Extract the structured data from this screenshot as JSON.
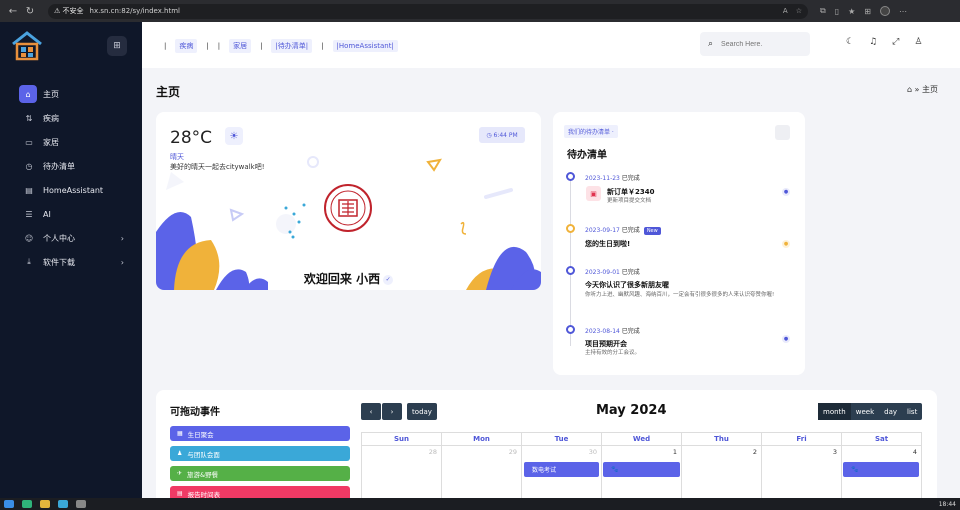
{
  "browser": {
    "security": "不安全",
    "url": "hx.sn.cn:82/sy/index.html"
  },
  "sidebar": {
    "items": [
      {
        "label": "主页",
        "icon": "home-icon"
      },
      {
        "label": "疾病",
        "icon": "route-icon"
      },
      {
        "label": "家居",
        "icon": "monitor-icon"
      },
      {
        "label": "待办清单",
        "icon": "clock-icon"
      },
      {
        "label": "HomeAssistant",
        "icon": "server-icon"
      },
      {
        "label": "AI",
        "icon": "storage-icon"
      },
      {
        "label": "个人中心",
        "icon": "users-icon"
      },
      {
        "label": "软件下载",
        "icon": "download-icon"
      }
    ]
  },
  "header": {
    "nav": [
      "疾病",
      "家居",
      "|待办清单|",
      "|HomeAssistant|"
    ],
    "search_placeholder": "Search Here."
  },
  "page": {
    "title": "主页",
    "breadcrumb": "主页"
  },
  "weather": {
    "temperature": "28°C",
    "condition": "晴天",
    "message": "美好的晴天一起去citywalk吧!",
    "time": "6:44 PM",
    "welcome": "欢迎回来 小西"
  },
  "todo": {
    "tag": "我们的待办清单",
    "title": "待办清单",
    "items": [
      {
        "date": "2023-11-23",
        "status": "已完成",
        "badge": "",
        "title": "新订单￥2340",
        "sub": "更新项目提交文档"
      },
      {
        "date": "2023-09-17",
        "status": "已完成",
        "badge": "New",
        "title": "您的生日到啦!",
        "sub": ""
      },
      {
        "date": "2023-09-01",
        "status": "已完成",
        "badge": "",
        "title": "今天你认识了很多新朋友喔",
        "sub": "你听力上进、幽默风趣、海纳百川，一定会有引很多很多的人来认识夸赞你喔!"
      },
      {
        "date": "2023-08-14",
        "status": "已完成",
        "badge": "",
        "title": "项目预期开会",
        "sub": "主持有效的分工会议。"
      }
    ]
  },
  "calendar": {
    "drag_title": "可拖动事件",
    "events": [
      {
        "label": "生日聚会",
        "color": "#5b63e8"
      },
      {
        "label": "与团队会面",
        "color": "#3aa8d8"
      },
      {
        "label": "旅游&野餐",
        "color": "#55b047"
      },
      {
        "label": "报告时间表",
        "color": "#f03a65"
      }
    ],
    "today_label": "today",
    "month_title": "May 2024",
    "views": [
      "month",
      "week",
      "day",
      "list"
    ],
    "weekdays": [
      "Sun",
      "Mon",
      "Tue",
      "Wed",
      "Thu",
      "Fri",
      "Sat"
    ],
    "week1": [
      "28",
      "29",
      "30",
      "1",
      "2",
      "3",
      "4"
    ],
    "cell_events": [
      {
        "label": "数电考试"
      },
      {
        "label": "🐾"
      },
      {
        "label": "🐾"
      }
    ]
  },
  "taskbar": {
    "clock": "18:44"
  }
}
